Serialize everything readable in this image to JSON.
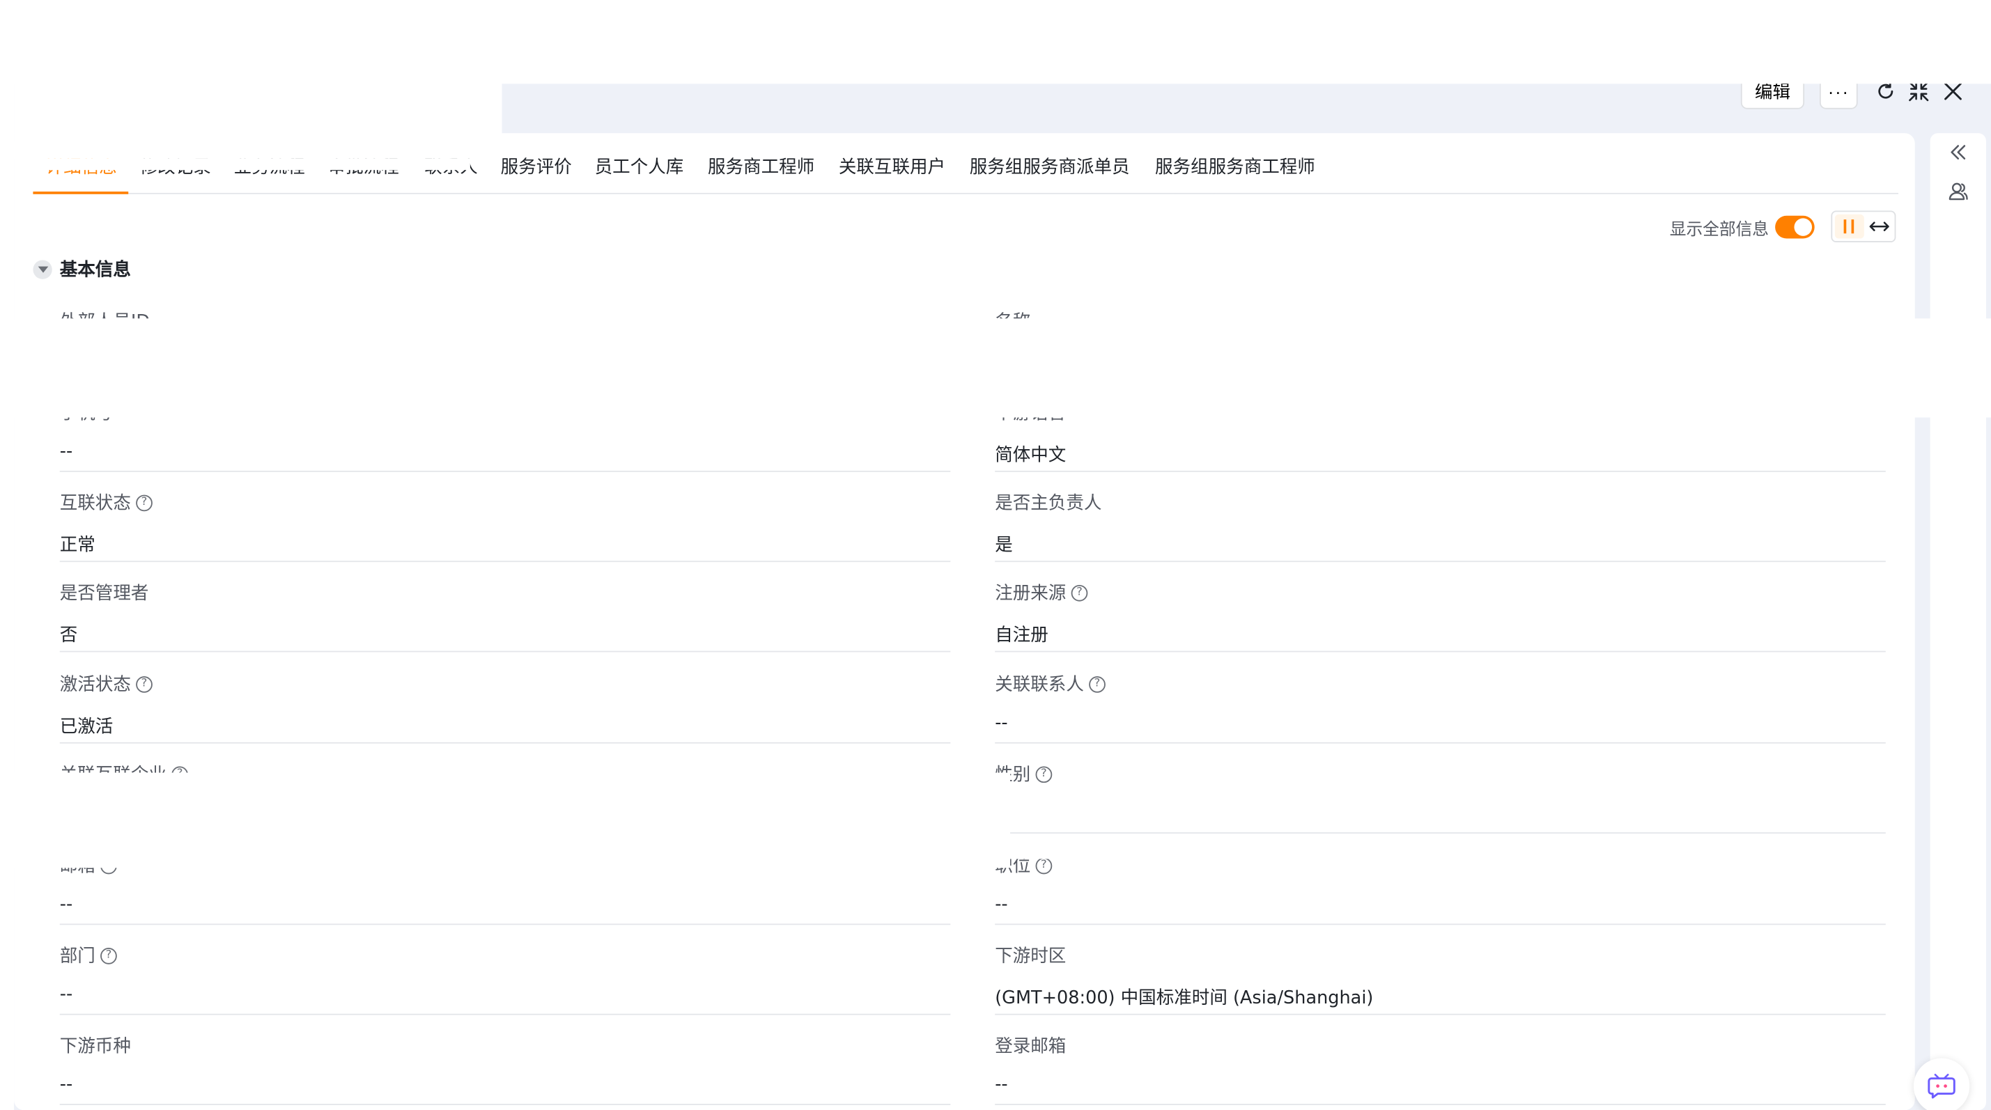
{
  "header": {
    "edit_label": "编辑",
    "more_label": "···",
    "refresh_icon": "refresh-icon",
    "collapse_icon": "collapse-icon",
    "close_icon": "close-icon"
  },
  "tabs": [
    {
      "label": "详细信息",
      "active": true
    },
    {
      "label": "修改记录"
    },
    {
      "label": "业务流程"
    },
    {
      "label": "审批流程"
    },
    {
      "label": "联系人"
    },
    {
      "label": "服务评价"
    },
    {
      "label": "员工个人库"
    },
    {
      "label": "服务商工程师"
    },
    {
      "label": "关联互联用户"
    },
    {
      "label": "服务组服务商派单员"
    },
    {
      "label": "服务组服务商工程师"
    }
  ],
  "toolbar": {
    "show_all_label": "显示全部信息",
    "show_all_on": true,
    "accent_color": "#ff8000"
  },
  "section": {
    "title": "基本信息"
  },
  "fields": {
    "left": [
      {
        "label": "外部人员ID",
        "value": "",
        "help": false
      },
      {
        "label": "手机号",
        "value": "--",
        "help": false
      },
      {
        "label": "互联状态",
        "value": "正常",
        "help": true
      },
      {
        "label": "是否管理者",
        "value": "否",
        "help": false
      },
      {
        "label": "激活状态",
        "value": "已激活",
        "help": true
      },
      {
        "label": "关联互联企业",
        "value": "",
        "help": true
      },
      {
        "label": "邮箱",
        "value": "--",
        "help": true
      },
      {
        "label": "部门",
        "value": "--",
        "help": true
      },
      {
        "label": "下游币种",
        "value": "--",
        "help": false
      }
    ],
    "right": [
      {
        "label": "名称",
        "value": "",
        "help": false
      },
      {
        "label": "下游语言",
        "value": "简体中文",
        "help": false
      },
      {
        "label": "是否主负责人",
        "value": "是",
        "help": false
      },
      {
        "label": "注册来源",
        "value": "自注册",
        "help": true
      },
      {
        "label": "关联联系人",
        "value": "--",
        "help": true
      },
      {
        "label": "性别",
        "value": "",
        "help": true
      },
      {
        "label": "职位",
        "value": "--",
        "help": true
      },
      {
        "label": "下游时区",
        "value": "(GMT+08:00) 中国标准时间 (Asia/Shanghai)",
        "help": false
      },
      {
        "label": "登录邮箱",
        "value": "--",
        "help": false
      }
    ]
  },
  "icons": {
    "section_caret": "caret-down-icon",
    "help": "help-icon",
    "rail_collapse": "double-chevron-left-icon",
    "rail_team": "team-icon",
    "assistant": "ai-assistant-icon",
    "layout_columns": "two-column-icon",
    "layout_expand": "horizontal-expand-icon"
  }
}
